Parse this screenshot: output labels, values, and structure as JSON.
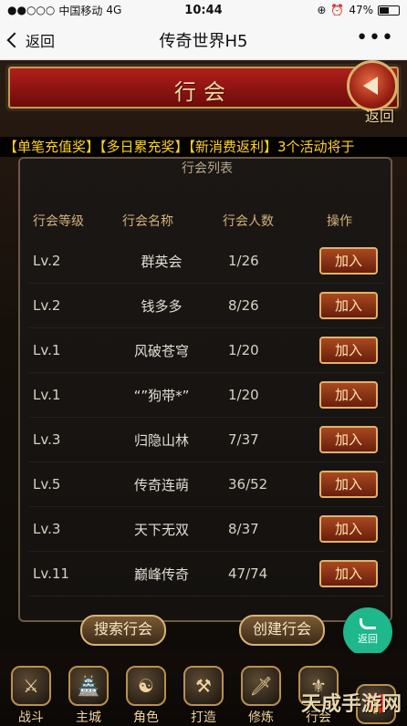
{
  "status_bar": {
    "carrier": "中国移动",
    "network": "4G",
    "time": "10:44",
    "battery": "47%"
  },
  "nav": {
    "back_label": "返回",
    "title": "传奇世界H5",
    "more_label": "•••"
  },
  "game": {
    "header_title": "行会",
    "back_label": "返回",
    "marquee": "【单笔充值奖】【多日累充奖】【新消费返利】3个活动将于",
    "panel_subtitle": "行会列表",
    "table_headers": {
      "level": "行会等级",
      "name": "行会名称",
      "count": "行会人数",
      "op": "操作"
    },
    "rows": [
      {
        "level": "Lv.2",
        "name": "群英会",
        "count": "1/26",
        "join": "加入"
      },
      {
        "level": "Lv.2",
        "name": "钱多多",
        "count": "8/26",
        "join": "加入"
      },
      {
        "level": "Lv.1",
        "name": "风破苍穹",
        "count": "1/20",
        "join": "加入"
      },
      {
        "level": "Lv.1",
        "name": "“”狗带*”",
        "count": "1/20",
        "join": "加入"
      },
      {
        "level": "Lv.3",
        "name": "归隐山林",
        "count": "7/37",
        "join": "加入"
      },
      {
        "level": "Lv.5",
        "name": "传奇连萌",
        "count": "36/52",
        "join": "加入"
      },
      {
        "level": "Lv.3",
        "name": "天下无双",
        "count": "8/37",
        "join": "加入"
      },
      {
        "level": "Lv.11",
        "name": "巅峰传奇",
        "count": "47/74",
        "join": "加入"
      }
    ],
    "search_button": "搜索行会",
    "create_button": "创建行会",
    "round_back_label": "返回",
    "menu": [
      {
        "label": "战斗",
        "icon": "axe-icon"
      },
      {
        "label": "主城",
        "icon": "castle-icon"
      },
      {
        "label": "角色",
        "icon": "character-icon"
      },
      {
        "label": "打造",
        "icon": "anvil-icon"
      },
      {
        "label": "修炼",
        "icon": "sword-icon"
      },
      {
        "label": "行会",
        "icon": "guild-icon"
      },
      {
        "label": "",
        "icon": "gift-icon"
      }
    ],
    "watermark": "天成手游网"
  }
}
